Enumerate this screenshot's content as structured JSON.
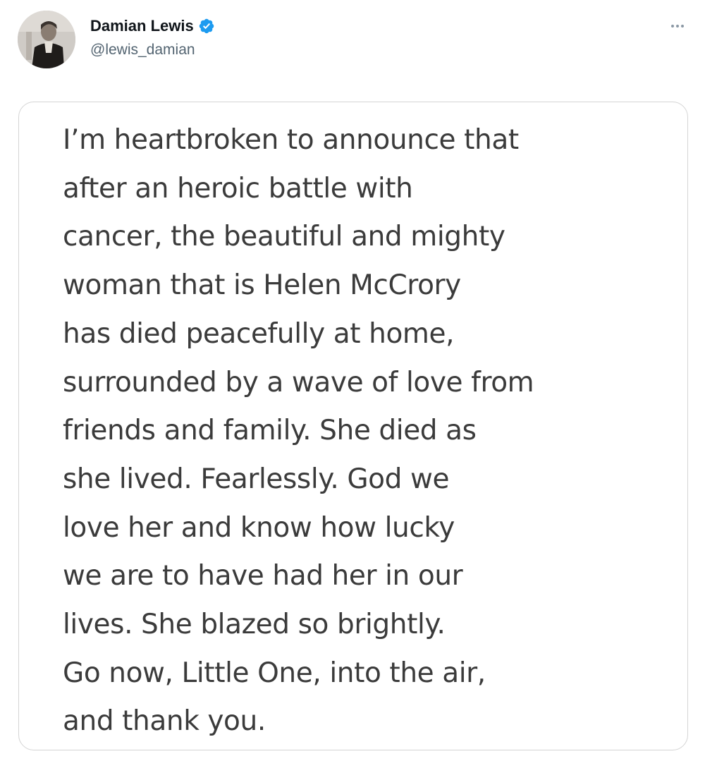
{
  "tweet": {
    "author": {
      "display_name": "Damian Lewis",
      "handle": "@lewis_damian",
      "verified": true
    },
    "more_options_icon": "ellipsis-icon",
    "media": {
      "statement_lines": [
        "I’m heartbroken to announce that",
        "after an heroic battle with",
        "cancer, the beautiful and mighty",
        "woman that is Helen McCrory",
        "has died peacefully at home,",
        "surrounded by a wave of love from",
        "friends and family. She died as",
        "she lived. Fearlessly. God we",
        "love her and know how lucky",
        "we are to have had her in our",
        "lives. She blazed so brightly.",
        "Go now, Little One, into the air,",
        "and thank you."
      ]
    }
  },
  "colors": {
    "verified_badge": "#1d9bf0",
    "name_text": "#0f1419",
    "handle_text": "#536471",
    "statement_text": "#3b3b3b",
    "card_border": "#d4d4d4"
  }
}
